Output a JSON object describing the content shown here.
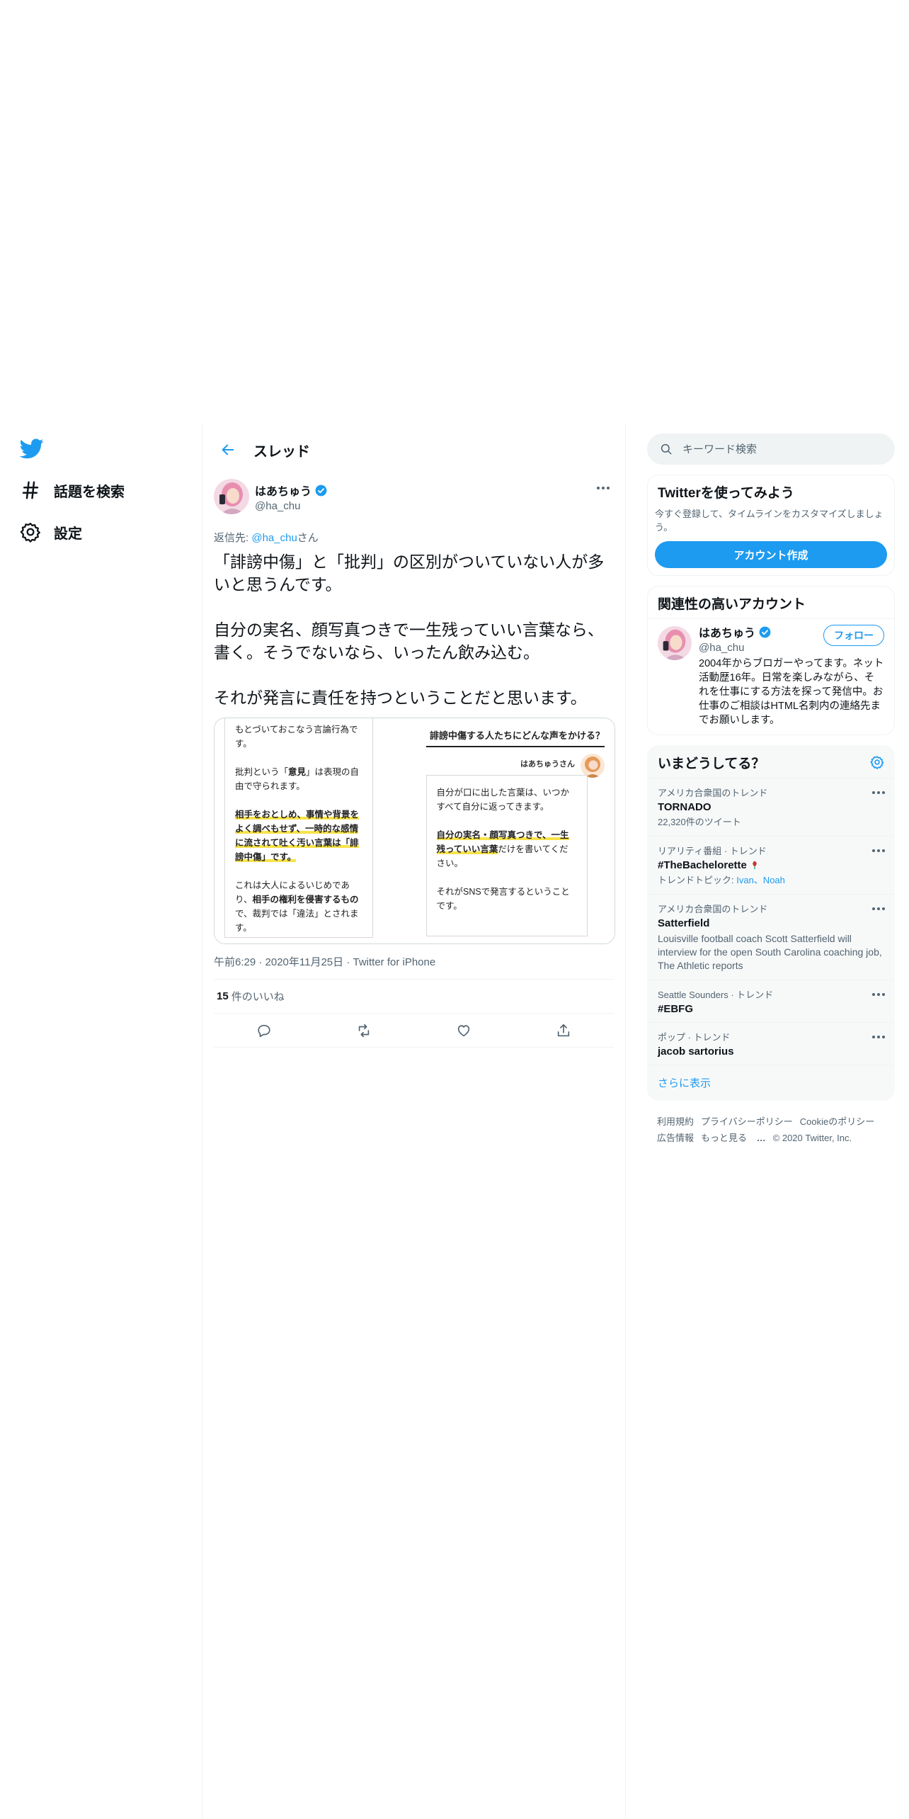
{
  "nav": {
    "explore_label": "話題を検索",
    "settings_label": "設定"
  },
  "thread": {
    "title": "スレッド"
  },
  "tweet": {
    "author_name": "はあちゅう",
    "author_handle": "@ha_chu",
    "reply_prefix": "返信先: ",
    "reply_handle": "@ha_chu",
    "reply_suffix": "さん",
    "body": "「誹謗中傷」と「批判」の区別がついていない人が多いと思うんです。\n\n自分の実名、顔写真つきで一生残っていい言葉なら、書く。そうでないなら、いったん飲み込む。\n\nそれが発言に責任を持つということだと思います。",
    "meta": "午前6:29 · 2020年11月25日 · Twitter for iPhone",
    "likes_count": "15",
    "likes_label": "件のいいね"
  },
  "media": {
    "left": {
      "p1": "もとづいておこなう言論行為です。",
      "p2_a": "批判という「",
      "p2_b": "意見",
      "p2_c": "」は表現の自由で守られます。",
      "p3": "相手をおとしめ、事情や背景をよく調べもせず、一時的な感情に流されて吐く汚い言葉は「誹謗中傷」です。",
      "p4_a": "これは大人によるいじめであり、",
      "p4_b": "相手の権利を侵害するもの",
      "p4_c": "で、裁判では「違法」とされます。"
    },
    "right": {
      "title": "誹謗中傷する人たちにどんな声をかける？",
      "name": "はあちゅうさん",
      "p1": "自分が口に出した言葉は、いつかすべて自分に返ってきます。",
      "p2_a": "自分の実名・顔写真つきで、一生残っていい言葉",
      "p2_b": "だけを書いてください。",
      "p3": "それがSNSで発言するということです。"
    }
  },
  "search": {
    "placeholder": "キーワード検索"
  },
  "signup": {
    "title": "Twitterを使ってみよう",
    "desc": "今すぐ登録して、タイムラインをカスタマイズしましょう。",
    "button": "アカウント作成"
  },
  "related": {
    "title": "関連性の高いアカウント",
    "name": "はあちゅう",
    "handle": "@ha_chu",
    "follow": "フォロー",
    "bio": "2004年からブロガーやってます。ネット活動歴16年。日常を楽しみながら、それを仕事にする方法を探って発信中。お仕事のご相談はHTML名刺内の連絡先までお願いします。"
  },
  "trends": {
    "title": "いまどうしてる？",
    "items": [
      {
        "context": "アメリカ合衆国のトレンド",
        "name": "TORNADO",
        "sub": "22,320件のツイート"
      },
      {
        "context": "リアリティ番組 · トレンド",
        "name": "#TheBachelorette",
        "sub_prefix": "トレンドトピック: ",
        "sub_links": "Ivan、Noah"
      },
      {
        "context": "アメリカ合衆国のトレンド",
        "name": "Satterfield",
        "desc": "Louisville football coach Scott Satterfield will interview for the open South Carolina coaching job, The Athletic reports"
      },
      {
        "context": "Seattle Sounders · トレンド",
        "name": "#EBFG"
      },
      {
        "context": "ポップ · トレンド",
        "name": "jacob sartorius"
      }
    ],
    "show_more": "さらに表示"
  },
  "footer": {
    "terms": "利用規約",
    "privacy": "プライバシーポリシー",
    "cookie": "Cookieのポリシー",
    "ads": "広告情報",
    "more": "もっと見る",
    "copyright": "© 2020 Twitter, Inc."
  },
  "colors": {
    "accent": "#1d9bf0",
    "text": "#0f1419",
    "secondary": "#536471",
    "highlight": "#f7e24a"
  }
}
